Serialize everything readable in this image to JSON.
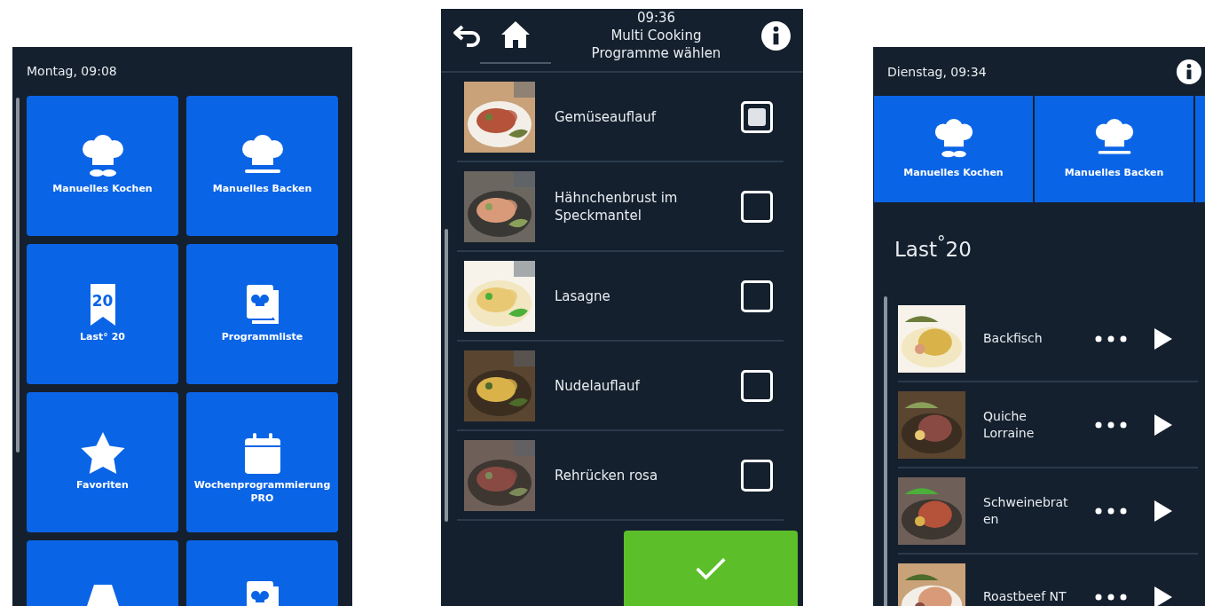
{
  "left_screen": {
    "status": "Montag, 09:08",
    "tiles": [
      {
        "kind": "cook",
        "label": "Manuelles Kochen"
      },
      {
        "kind": "bake",
        "label": "Manuelles Backen"
      },
      {
        "kind": "bookmark",
        "badge": "20",
        "label": "Last° 20"
      },
      {
        "kind": "list",
        "label": "Programmliste"
      },
      {
        "kind": "star",
        "label": "Favoriten"
      },
      {
        "kind": "calendar",
        "label": "Wochenprogrammierung PRO"
      },
      {
        "kind": "lamp"
      },
      {
        "kind": "list"
      }
    ]
  },
  "middle_screen": {
    "time": "09:36",
    "title": "Multi Cooking",
    "subtitle": "Programme wählen",
    "rows": [
      {
        "name": "Gemüseauflauf",
        "checked": true
      },
      {
        "name": "Hähnchenbrust im Speckmantel",
        "checked": false
      },
      {
        "name": "Lasagne",
        "checked": false
      },
      {
        "name": "Nudelauflauf",
        "checked": false
      },
      {
        "name": "Rehrücken rosa",
        "checked": false
      }
    ]
  },
  "right_screen": {
    "status": "Dienstag, 09:34",
    "tiles": [
      {
        "kind": "cook",
        "label": "Manuelles Kochen"
      },
      {
        "kind": "bake",
        "label": "Manuelles Backen"
      },
      {
        "kind": "blank"
      }
    ],
    "section_title": "Last$^{°}$20",
    "recipes": [
      {
        "name": "Backfisch"
      },
      {
        "name": "Quiche Lorraine"
      },
      {
        "name": "Schweinebraten"
      },
      {
        "name": "Roastbeef NT"
      }
    ]
  }
}
